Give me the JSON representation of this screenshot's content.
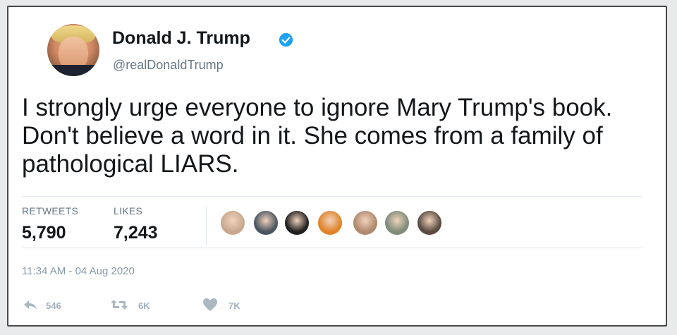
{
  "tweet": {
    "display_name": "Donald J. Trump",
    "handle": "@realDonaldTrump",
    "text": "I strongly urge everyone to ignore Mary Trump's book. Don't believe a word in it. She comes from a family of pathological LIARS.",
    "timestamp": "11:34 AM - 04 Aug 2020",
    "verified": true
  },
  "stats": {
    "retweets_label": "RETWEETS",
    "retweets_value": "5,790",
    "likes_label": "LIKES",
    "likes_value": "7,243"
  },
  "liker_avatars": [
    {
      "color": "#c9a98e"
    },
    {
      "color": "#4b5560"
    },
    {
      "color": "#202020"
    },
    {
      "color": "#e0842a"
    },
    {
      "color": "#b08a6e"
    },
    {
      "color": "#7e8c78"
    },
    {
      "color": "#5a4a40"
    }
  ],
  "actions": {
    "reply_count": "546",
    "retweet_count": "6K",
    "like_count": "7K"
  },
  "colors": {
    "verified": "#1da1f2",
    "text": "#14171a",
    "muted": "#657786"
  },
  "icons": {
    "verified": "verified-badge-icon",
    "reply": "reply-icon",
    "retweet": "retweet-icon",
    "like": "heart-icon"
  }
}
